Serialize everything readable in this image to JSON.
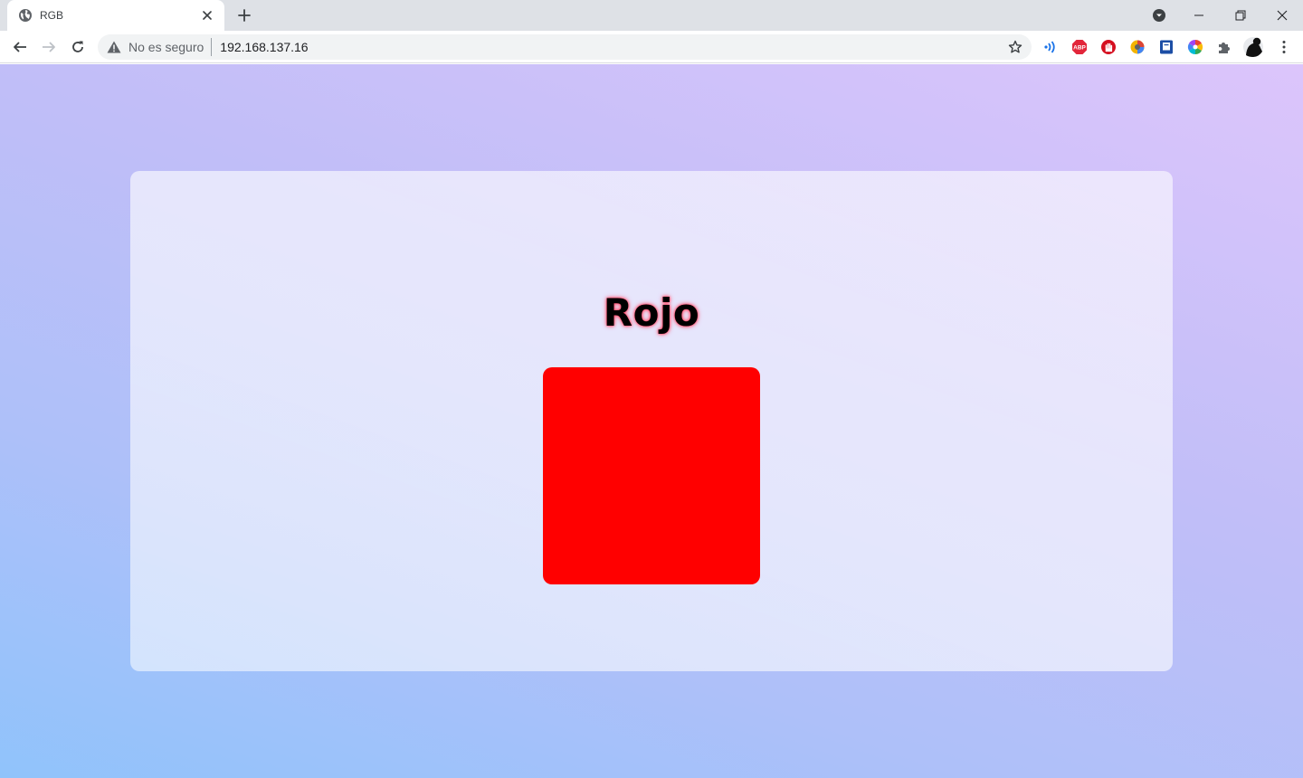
{
  "browser": {
    "tab_title": "RGB",
    "security_label": "No es seguro",
    "url": "192.168.137.16"
  },
  "page": {
    "color_name": "Rojo",
    "color_hex": "#ff0000"
  },
  "icons": [
    "globe-icon",
    "close-icon",
    "plus-icon",
    "tab-search-icon",
    "minimize-icon",
    "restore-icon",
    "window-close-icon",
    "back-arrow-icon",
    "forward-arrow-icon",
    "reload-icon",
    "warning-icon",
    "star-icon",
    "read-aloud-extension-icon",
    "adblock-plus-icon",
    "stop-hand-extension-icon",
    "color-picker-extension-icon",
    "book-extension-icon",
    "color-wheel-extension-icon",
    "puzzle-extensions-icon",
    "profile-avatar",
    "kebab-menu-icon"
  ]
}
